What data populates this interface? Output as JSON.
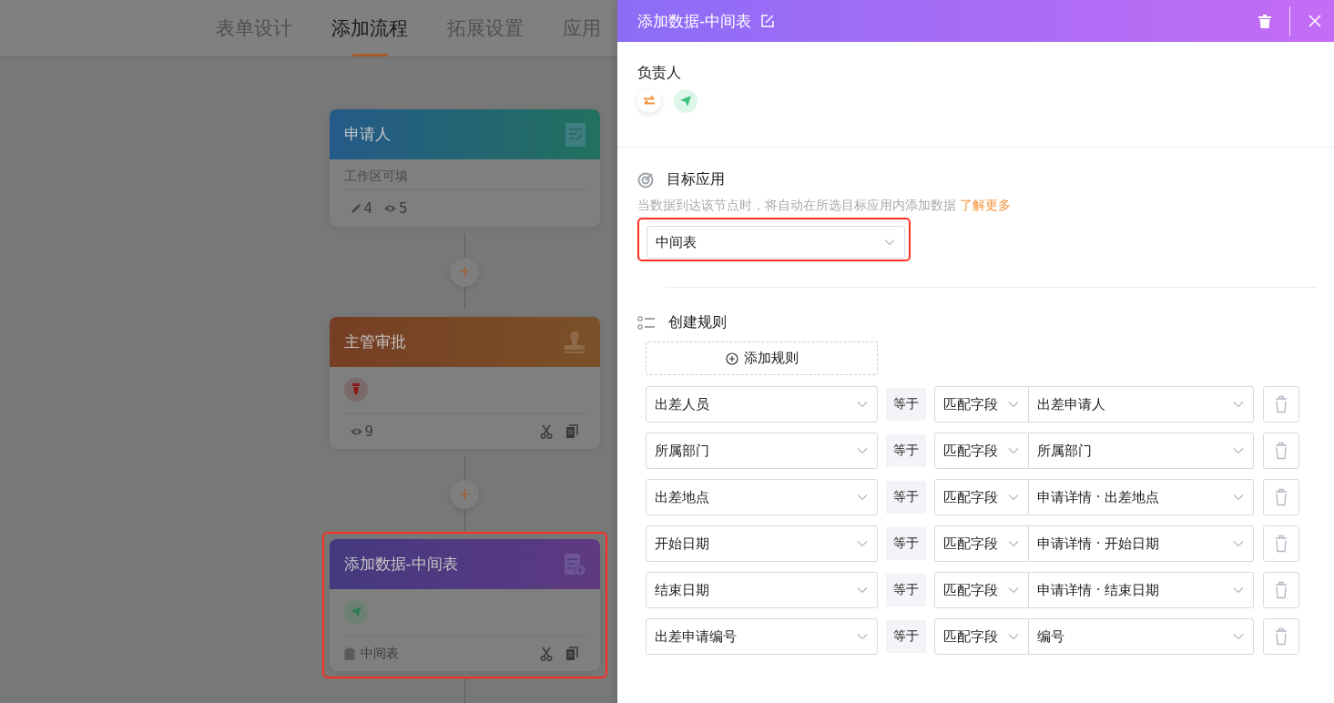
{
  "tabs": [
    {
      "label": "表单设计",
      "selected": false
    },
    {
      "label": "添加流程",
      "selected": true
    },
    {
      "label": "拓展设置",
      "selected": false
    },
    {
      "label": "应用",
      "selected": false
    }
  ],
  "flow_nodes": [
    {
      "kind": "start",
      "title": "申请人",
      "subtitle": "工作区可填",
      "edit_count": "4",
      "view_count": "5",
      "selected": false
    },
    {
      "kind": "approval",
      "title": "主管审批",
      "view_count": "9",
      "selected": false
    },
    {
      "kind": "add_data",
      "title": "添加数据-中间表",
      "target": "中间表",
      "selected": true
    }
  ],
  "drawer": {
    "title": "添加数据-中间表",
    "owner_label": "负责人",
    "target_app": {
      "heading": "目标应用",
      "description": "当数据到达该节点时，将自动在所选目标应用内添加数据",
      "link": "了解更多",
      "value": "中间表",
      "highlighted": true
    },
    "rules": {
      "heading": "创建规则",
      "add_button": "添加规则",
      "rows": [
        {
          "field": "出差人员",
          "operator": "等于",
          "match_type": "匹配字段",
          "value": "出差申请人"
        },
        {
          "field": "所属部门",
          "operator": "等于",
          "match_type": "匹配字段",
          "value": "所属部门"
        },
        {
          "field": "出差地点",
          "operator": "等于",
          "match_type": "匹配字段",
          "value": "申请详情 · 出差地点"
        },
        {
          "field": "开始日期",
          "operator": "等于",
          "match_type": "匹配字段",
          "value": "申请详情 · 开始日期"
        },
        {
          "field": "结束日期",
          "operator": "等于",
          "match_type": "匹配字段",
          "value": "申请详情 · 结束日期"
        },
        {
          "field": "出差申请编号",
          "operator": "等于",
          "match_type": "匹配字段",
          "value": "编号"
        }
      ]
    }
  }
}
